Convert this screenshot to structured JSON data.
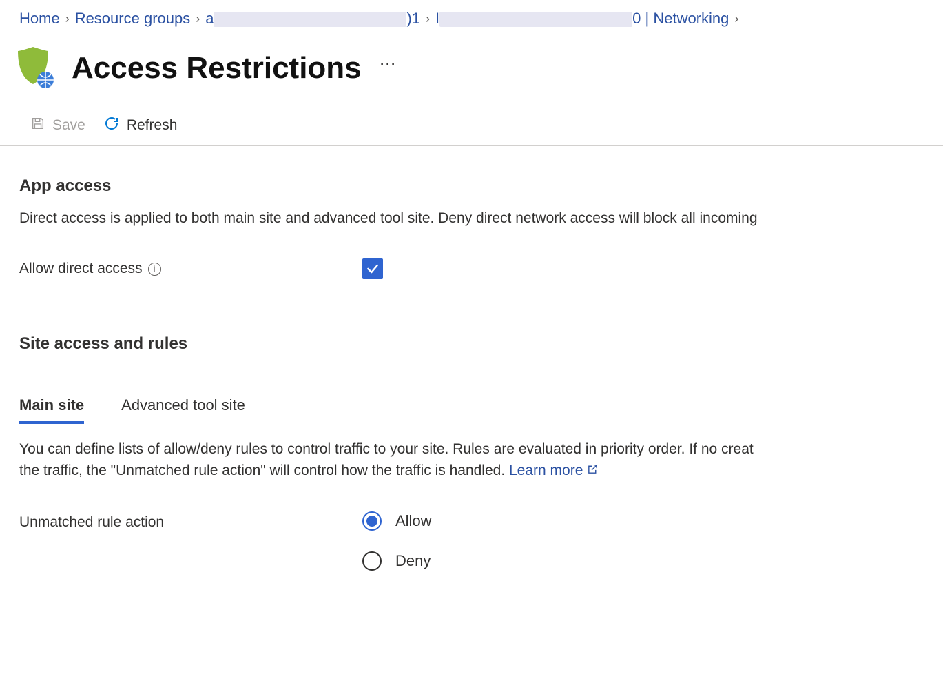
{
  "breadcrumb": {
    "home": "Home",
    "resource_groups": "Resource groups",
    "rg_prefix": "a",
    "rg_suffix": ")1",
    "app_prefix": "I",
    "app_suffix": "0",
    "networking": " | Networking"
  },
  "page": {
    "title": "Access Restrictions"
  },
  "toolbar": {
    "save": "Save",
    "refresh": "Refresh"
  },
  "app_access": {
    "heading": "App access",
    "desc": "Direct access is applied to both main site and advanced tool site. Deny direct network access will block all incoming",
    "allow_label": "Allow direct access",
    "allow_checked": true
  },
  "site_access": {
    "heading": "Site access and rules",
    "tabs": [
      {
        "label": "Main site",
        "active": true
      },
      {
        "label": "Advanced tool site",
        "active": false
      }
    ],
    "desc_line1": "You can define lists of allow/deny rules to control traffic to your site. Rules are evaluated in priority order. If no creat",
    "desc_line2_prefix": "the traffic, the \"Unmatched rule action\" will control how the traffic is handled. ",
    "learn_more": "Learn more",
    "unmatched_label": "Unmatched rule action",
    "radios": [
      {
        "label": "Allow",
        "checked": true
      },
      {
        "label": "Deny",
        "checked": false
      }
    ]
  }
}
